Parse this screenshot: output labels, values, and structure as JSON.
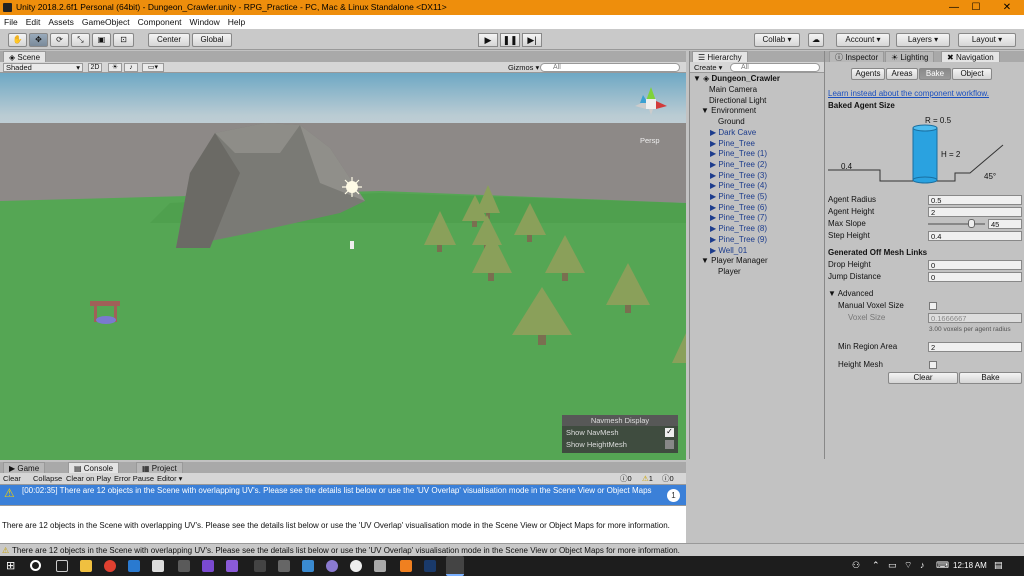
{
  "window": {
    "title": "Unity 2018.2.6f1 Personal (64bit) - Dungeon_Crawler.unity - RPG_Practice - PC, Mac & Linux Standalone <DX11>",
    "minimize": "—",
    "maximize": "☐",
    "close": "✕"
  },
  "menu": [
    "File",
    "Edit",
    "Assets",
    "GameObject",
    "Component",
    "Window",
    "Help"
  ],
  "toolbar": {
    "center": "Center",
    "global": "Global",
    "collab": "Collab",
    "account": "Account",
    "layers": "Layers",
    "layout": "Layout"
  },
  "scene": {
    "tab": "Scene",
    "shading": "Shaded",
    "mode_2d": "2D",
    "gizmos": "Gizmos",
    "search_placeholder": "All",
    "persp": "Persp",
    "navmesh_panel": {
      "title": "Navmesh Display",
      "show_navmesh": "Show NavMesh",
      "show_navmesh_checked": true,
      "show_heightmesh": "Show HeightMesh",
      "show_heightmesh_checked": false
    }
  },
  "hierarchy": {
    "tab": "Hierarchy",
    "create": "Create",
    "search_placeholder": "All",
    "scene_name": "Dungeon_Crawler",
    "items": [
      {
        "label": "Main Camera",
        "indent": 1,
        "arrow": "",
        "prefab": false
      },
      {
        "label": "Directional Light",
        "indent": 1,
        "arrow": "",
        "prefab": false
      },
      {
        "label": "Environment",
        "indent": 1,
        "arrow": "▼",
        "prefab": false
      },
      {
        "label": "Ground",
        "indent": 2,
        "arrow": "",
        "prefab": false
      },
      {
        "label": "Dark Cave",
        "indent": 2,
        "arrow": "▶",
        "prefab": true
      },
      {
        "label": "Pine_Tree",
        "indent": 2,
        "arrow": "▶",
        "prefab": true
      },
      {
        "label": "Pine_Tree (1)",
        "indent": 2,
        "arrow": "▶",
        "prefab": true
      },
      {
        "label": "Pine_Tree (2)",
        "indent": 2,
        "arrow": "▶",
        "prefab": true
      },
      {
        "label": "Pine_Tree (3)",
        "indent": 2,
        "arrow": "▶",
        "prefab": true
      },
      {
        "label": "Pine_Tree (4)",
        "indent": 2,
        "arrow": "▶",
        "prefab": true
      },
      {
        "label": "Pine_Tree (5)",
        "indent": 2,
        "arrow": "▶",
        "prefab": true
      },
      {
        "label": "Pine_Tree (6)",
        "indent": 2,
        "arrow": "▶",
        "prefab": true
      },
      {
        "label": "Pine_Tree (7)",
        "indent": 2,
        "arrow": "▶",
        "prefab": true
      },
      {
        "label": "Pine_Tree (8)",
        "indent": 2,
        "arrow": "▶",
        "prefab": true
      },
      {
        "label": "Pine_Tree (9)",
        "indent": 2,
        "arrow": "▶",
        "prefab": true
      },
      {
        "label": "Well_01",
        "indent": 2,
        "arrow": "▶",
        "prefab": true
      },
      {
        "label": "Player Manager",
        "indent": 1,
        "arrow": "▼",
        "prefab": false
      },
      {
        "label": "Player",
        "indent": 2,
        "arrow": "",
        "prefab": false
      }
    ]
  },
  "inspector": {
    "tabs": [
      "Inspector",
      "Lighting",
      "Navigation"
    ],
    "subtabs": [
      "Agents",
      "Areas",
      "Bake",
      "Object"
    ],
    "link": "Learn instead about the component workflow.",
    "section_baked": "Baked Agent Size",
    "diagram": {
      "r": "R = 0.5",
      "h": "H = 2",
      "step": "0.4",
      "slope": "45°"
    },
    "fields": [
      {
        "label": "Agent Radius",
        "value": "0.5"
      },
      {
        "label": "Agent Height",
        "value": "2"
      },
      {
        "label": "Max Slope",
        "value": "45"
      },
      {
        "label": "Step Height",
        "value": "0.4"
      }
    ],
    "max_slope_fraction": 0.75,
    "section_offmesh": "Generated Off Mesh Links",
    "offmesh_fields": [
      {
        "label": "Drop Height",
        "value": "0"
      },
      {
        "label": "Jump Distance",
        "value": "0"
      }
    ],
    "advanced": "Advanced",
    "manual_voxel": "Manual Voxel Size",
    "voxel_size_label": "Voxel Size",
    "voxel_size_value": "0.1666667",
    "voxel_note": "3.00 voxels per agent radius",
    "min_region_label": "Min Region Area",
    "min_region_value": "2",
    "height_mesh": "Height Mesh",
    "clear": "Clear",
    "bake": "Bake"
  },
  "console": {
    "tabs": [
      "Game",
      "Console",
      "Project"
    ],
    "toolbar": [
      "Clear",
      "Collapse",
      "Clear on Play",
      "Error Pause",
      "Editor"
    ],
    "counts": {
      "info": "0",
      "warn": "1",
      "error": "0"
    },
    "row_text": "[00:02:35] There are 12 objects in the Scene with overlapping UV's. Please see the details list below or use the 'UV Overlap' visualisation mode in the Scene View or Object Maps",
    "row_count": "1",
    "detail": "There are 12 objects in the Scene with overlapping UV's. Please see the details list below or use the 'UV Overlap' visualisation mode in the Scene View or Object Maps for more information."
  },
  "status": "There are 12 objects in the Scene with overlapping UV's. Please see the details list below or use the 'UV Overlap' visualisation mode in the Scene View or Object Maps for more information.",
  "taskbar": {
    "time": "12:18 AM"
  }
}
